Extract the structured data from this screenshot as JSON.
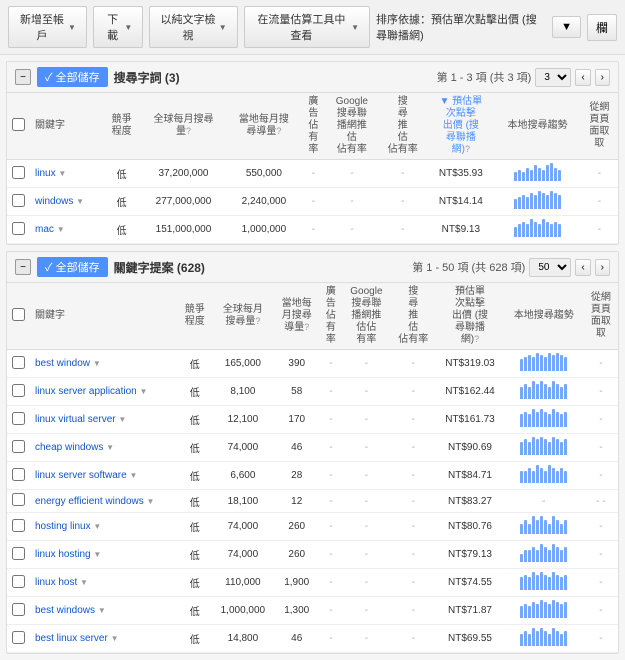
{
  "toolbar": {
    "add_account_label": "新增至帳戶",
    "download_label": "下載",
    "text_search_label": "以純文字檢視",
    "tools_label": "在流量估算工具中查看",
    "sort_label": "排序依據：預估單次點擊出價 (搜尋聯播網)",
    "grid_label": "欄"
  },
  "sections": [
    {
      "id": "search-terms",
      "collapse_label": "−",
      "save_label": "✓ 全部儲存",
      "title": "搜尋字詞 (3)",
      "nav": "第 1 - 3 項 (共 3 項)",
      "columns": [
        {
          "id": "keyword",
          "label": "關鍵字",
          "align": "left"
        },
        {
          "id": "competition",
          "label": "競爭程度",
          "align": "center"
        },
        {
          "id": "global_monthly",
          "label": "全球每月搜尋量",
          "align": "center",
          "help": "?"
        },
        {
          "id": "local_monthly",
          "label": "當地每月搜尋導量",
          "align": "center",
          "help": "?"
        },
        {
          "id": "ad_share",
          "label": "廣告佔有率",
          "align": "center"
        },
        {
          "id": "google_search",
          "label": "Google 搜尋聯播網推估佔有率",
          "align": "center"
        },
        {
          "id": "search_share",
          "label": "搜尋推估佔有率",
          "align": "center"
        },
        {
          "id": "cpc",
          "label": "預估單次點擊出價 (搜尋聯播網)",
          "align": "center",
          "help": "?",
          "sort": true
        },
        {
          "id": "trend",
          "label": "本地搜尋趨勢",
          "align": "center"
        },
        {
          "id": "extracted",
          "label": "從網頁頁面取取",
          "align": "center"
        }
      ],
      "rows": [
        {
          "keyword": "linux",
          "competition": "低",
          "global_monthly": "37,200,000",
          "local_monthly": "550,000",
          "ad_share": "-",
          "google_search": "-",
          "search_share": "-",
          "cpc": "NT$35.93",
          "extracted": "-",
          "trend": [
            3,
            4,
            3,
            5,
            4,
            6,
            5,
            4,
            6,
            7,
            5,
            4
          ]
        },
        {
          "keyword": "windows",
          "competition": "低",
          "global_monthly": "277,000,000",
          "local_monthly": "2,240,000",
          "ad_share": "-",
          "google_search": "-",
          "search_share": "-",
          "cpc": "NT$14.14",
          "extracted": "-",
          "trend": [
            4,
            5,
            6,
            5,
            7,
            6,
            8,
            7,
            6,
            8,
            7,
            6
          ]
        },
        {
          "keyword": "mac",
          "competition": "低",
          "global_monthly": "151,000,000",
          "local_monthly": "1,000,000",
          "ad_share": "-",
          "google_search": "-",
          "search_share": "-",
          "cpc": "NT$9.13",
          "extracted": "-",
          "trend": [
            3,
            4,
            5,
            4,
            6,
            5,
            4,
            6,
            5,
            4,
            5,
            4
          ]
        }
      ]
    },
    {
      "id": "keyword-ideas",
      "collapse_label": "−",
      "save_label": "✓ 全部儲存",
      "title": "關鍵字提案 (628)",
      "nav": "第 1 - 50 項 (共 628 項)",
      "columns": [
        {
          "id": "keyword",
          "label": "關鍵字",
          "align": "left"
        },
        {
          "id": "competition",
          "label": "競爭程度",
          "align": "center"
        },
        {
          "id": "global_monthly",
          "label": "全球每月搜尋量",
          "align": "center",
          "help": "?"
        },
        {
          "id": "local_monthly",
          "label": "當地每月搜尋導量",
          "align": "center",
          "help": "?"
        },
        {
          "id": "ad_share",
          "label": "廣告佔有率",
          "align": "center"
        },
        {
          "id": "google_search",
          "label": "Google 搜尋聯播網推估佔有率",
          "align": "center"
        },
        {
          "id": "search_share",
          "label": "搜尋推估佔有率",
          "align": "center"
        },
        {
          "id": "cpc",
          "label": "預估單次點擊出價 (搜尋聯播網)",
          "align": "center",
          "help": "?"
        },
        {
          "id": "trend",
          "label": "本地搜尋趨勢",
          "align": "center"
        },
        {
          "id": "extracted",
          "label": "從網頁頁面取取",
          "align": "center"
        }
      ],
      "rows": [
        {
          "keyword": "best window",
          "competition": "低",
          "global_monthly": "165,000",
          "local_monthly": "390",
          "ad_share": "-",
          "google_search": "-",
          "search_share": "-",
          "cpc": "NT$319.03",
          "extracted": "-",
          "trend": [
            5,
            6,
            7,
            6,
            8,
            7,
            6,
            8,
            7,
            8,
            7,
            6
          ]
        },
        {
          "keyword": "linux server application",
          "competition": "低",
          "global_monthly": "8,100",
          "local_monthly": "58",
          "ad_share": "-",
          "google_search": "-",
          "search_share": "-",
          "cpc": "NT$162.44",
          "extracted": "-",
          "trend": [
            3,
            4,
            3,
            5,
            4,
            5,
            4,
            3,
            5,
            4,
            3,
            4
          ]
        },
        {
          "keyword": "linux virtual server",
          "competition": "低",
          "global_monthly": "12,100",
          "local_monthly": "170",
          "ad_share": "-",
          "google_search": "-",
          "search_share": "-",
          "cpc": "NT$161.73",
          "extracted": "-",
          "trend": [
            4,
            5,
            4,
            6,
            5,
            6,
            5,
            4,
            6,
            5,
            4,
            5
          ]
        },
        {
          "keyword": "cheap windows",
          "competition": "低",
          "global_monthly": "74,000",
          "local_monthly": "46",
          "ad_share": "-",
          "google_search": "-",
          "search_share": "-",
          "cpc": "NT$90.69",
          "extracted": "-",
          "trend": [
            5,
            6,
            5,
            7,
            6,
            7,
            6,
            5,
            7,
            6,
            5,
            6
          ]
        },
        {
          "keyword": "linux server software",
          "competition": "低",
          "global_monthly": "6,600",
          "local_monthly": "28",
          "ad_share": "-",
          "google_search": "-",
          "search_share": "-",
          "cpc": "NT$84.71",
          "extracted": "-",
          "trend": [
            3,
            3,
            4,
            3,
            5,
            4,
            3,
            5,
            4,
            3,
            4,
            3
          ]
        },
        {
          "keyword": "energy efficient windows",
          "competition": "低",
          "global_monthly": "18,100",
          "local_monthly": "12",
          "ad_share": "-",
          "google_search": "-",
          "search_share": "-",
          "cpc": "NT$83.27",
          "extracted": "- -",
          "trend": []
        },
        {
          "keyword": "hosting linux",
          "competition": "低",
          "global_monthly": "74,000",
          "local_monthly": "260",
          "ad_share": "-",
          "google_search": "-",
          "search_share": "-",
          "cpc": "NT$80.76",
          "extracted": "-",
          "trend": [
            2,
            3,
            2,
            4,
            3,
            4,
            3,
            2,
            4,
            3,
            2,
            3
          ]
        },
        {
          "keyword": "linux hosting",
          "competition": "低",
          "global_monthly": "74,000",
          "local_monthly": "260",
          "ad_share": "-",
          "google_search": "-",
          "search_share": "-",
          "cpc": "NT$79.13",
          "extracted": "-",
          "trend": [
            2,
            3,
            3,
            4,
            3,
            5,
            4,
            3,
            5,
            4,
            3,
            4
          ]
        },
        {
          "keyword": "linux host",
          "competition": "低",
          "global_monthly": "110,000",
          "local_monthly": "1,900",
          "ad_share": "-",
          "google_search": "-",
          "search_share": "-",
          "cpc": "NT$74.55",
          "extracted": "-",
          "trend": [
            4,
            5,
            4,
            6,
            5,
            6,
            5,
            4,
            6,
            5,
            4,
            5
          ]
        },
        {
          "keyword": "best windows",
          "competition": "低",
          "global_monthly": "1,000,000",
          "local_monthly": "1,300",
          "ad_share": "-",
          "google_search": "-",
          "search_share": "-",
          "cpc": "NT$71.87",
          "extracted": "-",
          "trend": [
            5,
            6,
            5,
            7,
            6,
            8,
            7,
            6,
            8,
            7,
            6,
            7
          ]
        },
        {
          "keyword": "best linux server",
          "competition": "低",
          "global_monthly": "14,800",
          "local_monthly": "46",
          "ad_share": "-",
          "google_search": "-",
          "search_share": "-",
          "cpc": "NT$69.55",
          "extracted": "-",
          "trend": [
            3,
            4,
            3,
            5,
            4,
            5,
            4,
            3,
            5,
            4,
            3,
            4
          ]
        }
      ]
    }
  ]
}
